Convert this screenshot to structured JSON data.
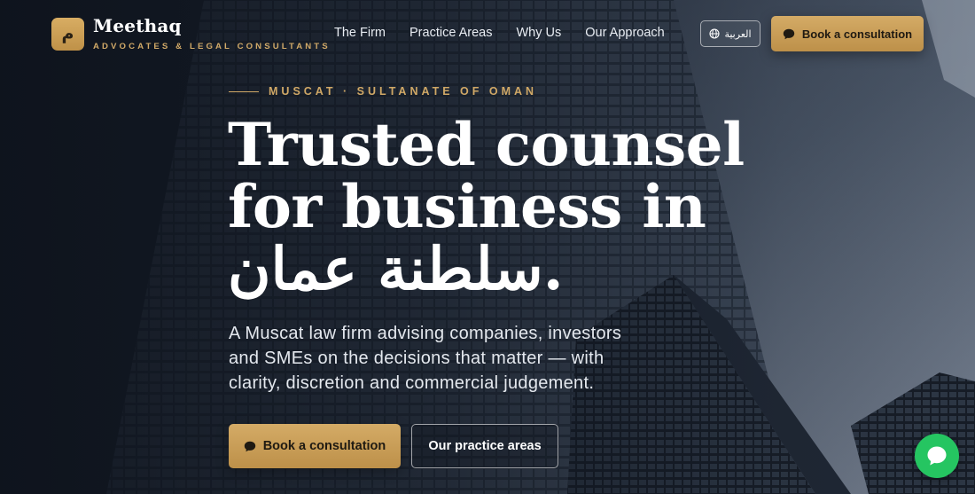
{
  "brand": {
    "mark": "م",
    "name": "Meethaq",
    "tagline": "ADVOCATES & LEGAL CONSULTANTS"
  },
  "nav": {
    "items": [
      "The Firm",
      "Practice Areas",
      "Why Us",
      "Our Approach"
    ]
  },
  "header": {
    "language_label": "العربية",
    "cta_label": "Book a consultation"
  },
  "hero": {
    "kicker": "MUSCAT · SULTANATE OF OMAN",
    "headline": "Trusted counsel for business in سلطنة عمان.",
    "lede": "A Muscat law firm advising companies, investors and SMEs on the decisions that matter — with clarity, discretion and commercial judgement.",
    "primary_cta": "Book a consultation",
    "secondary_cta": "Our practice areas"
  },
  "icons": {
    "language": "globe-icon",
    "cta": "chat-bubble-icon",
    "floating": "whatsapp-chat-icon"
  },
  "colors": {
    "accent": "#c9a05a",
    "chat": "#25c561",
    "text": "#ffffff"
  }
}
